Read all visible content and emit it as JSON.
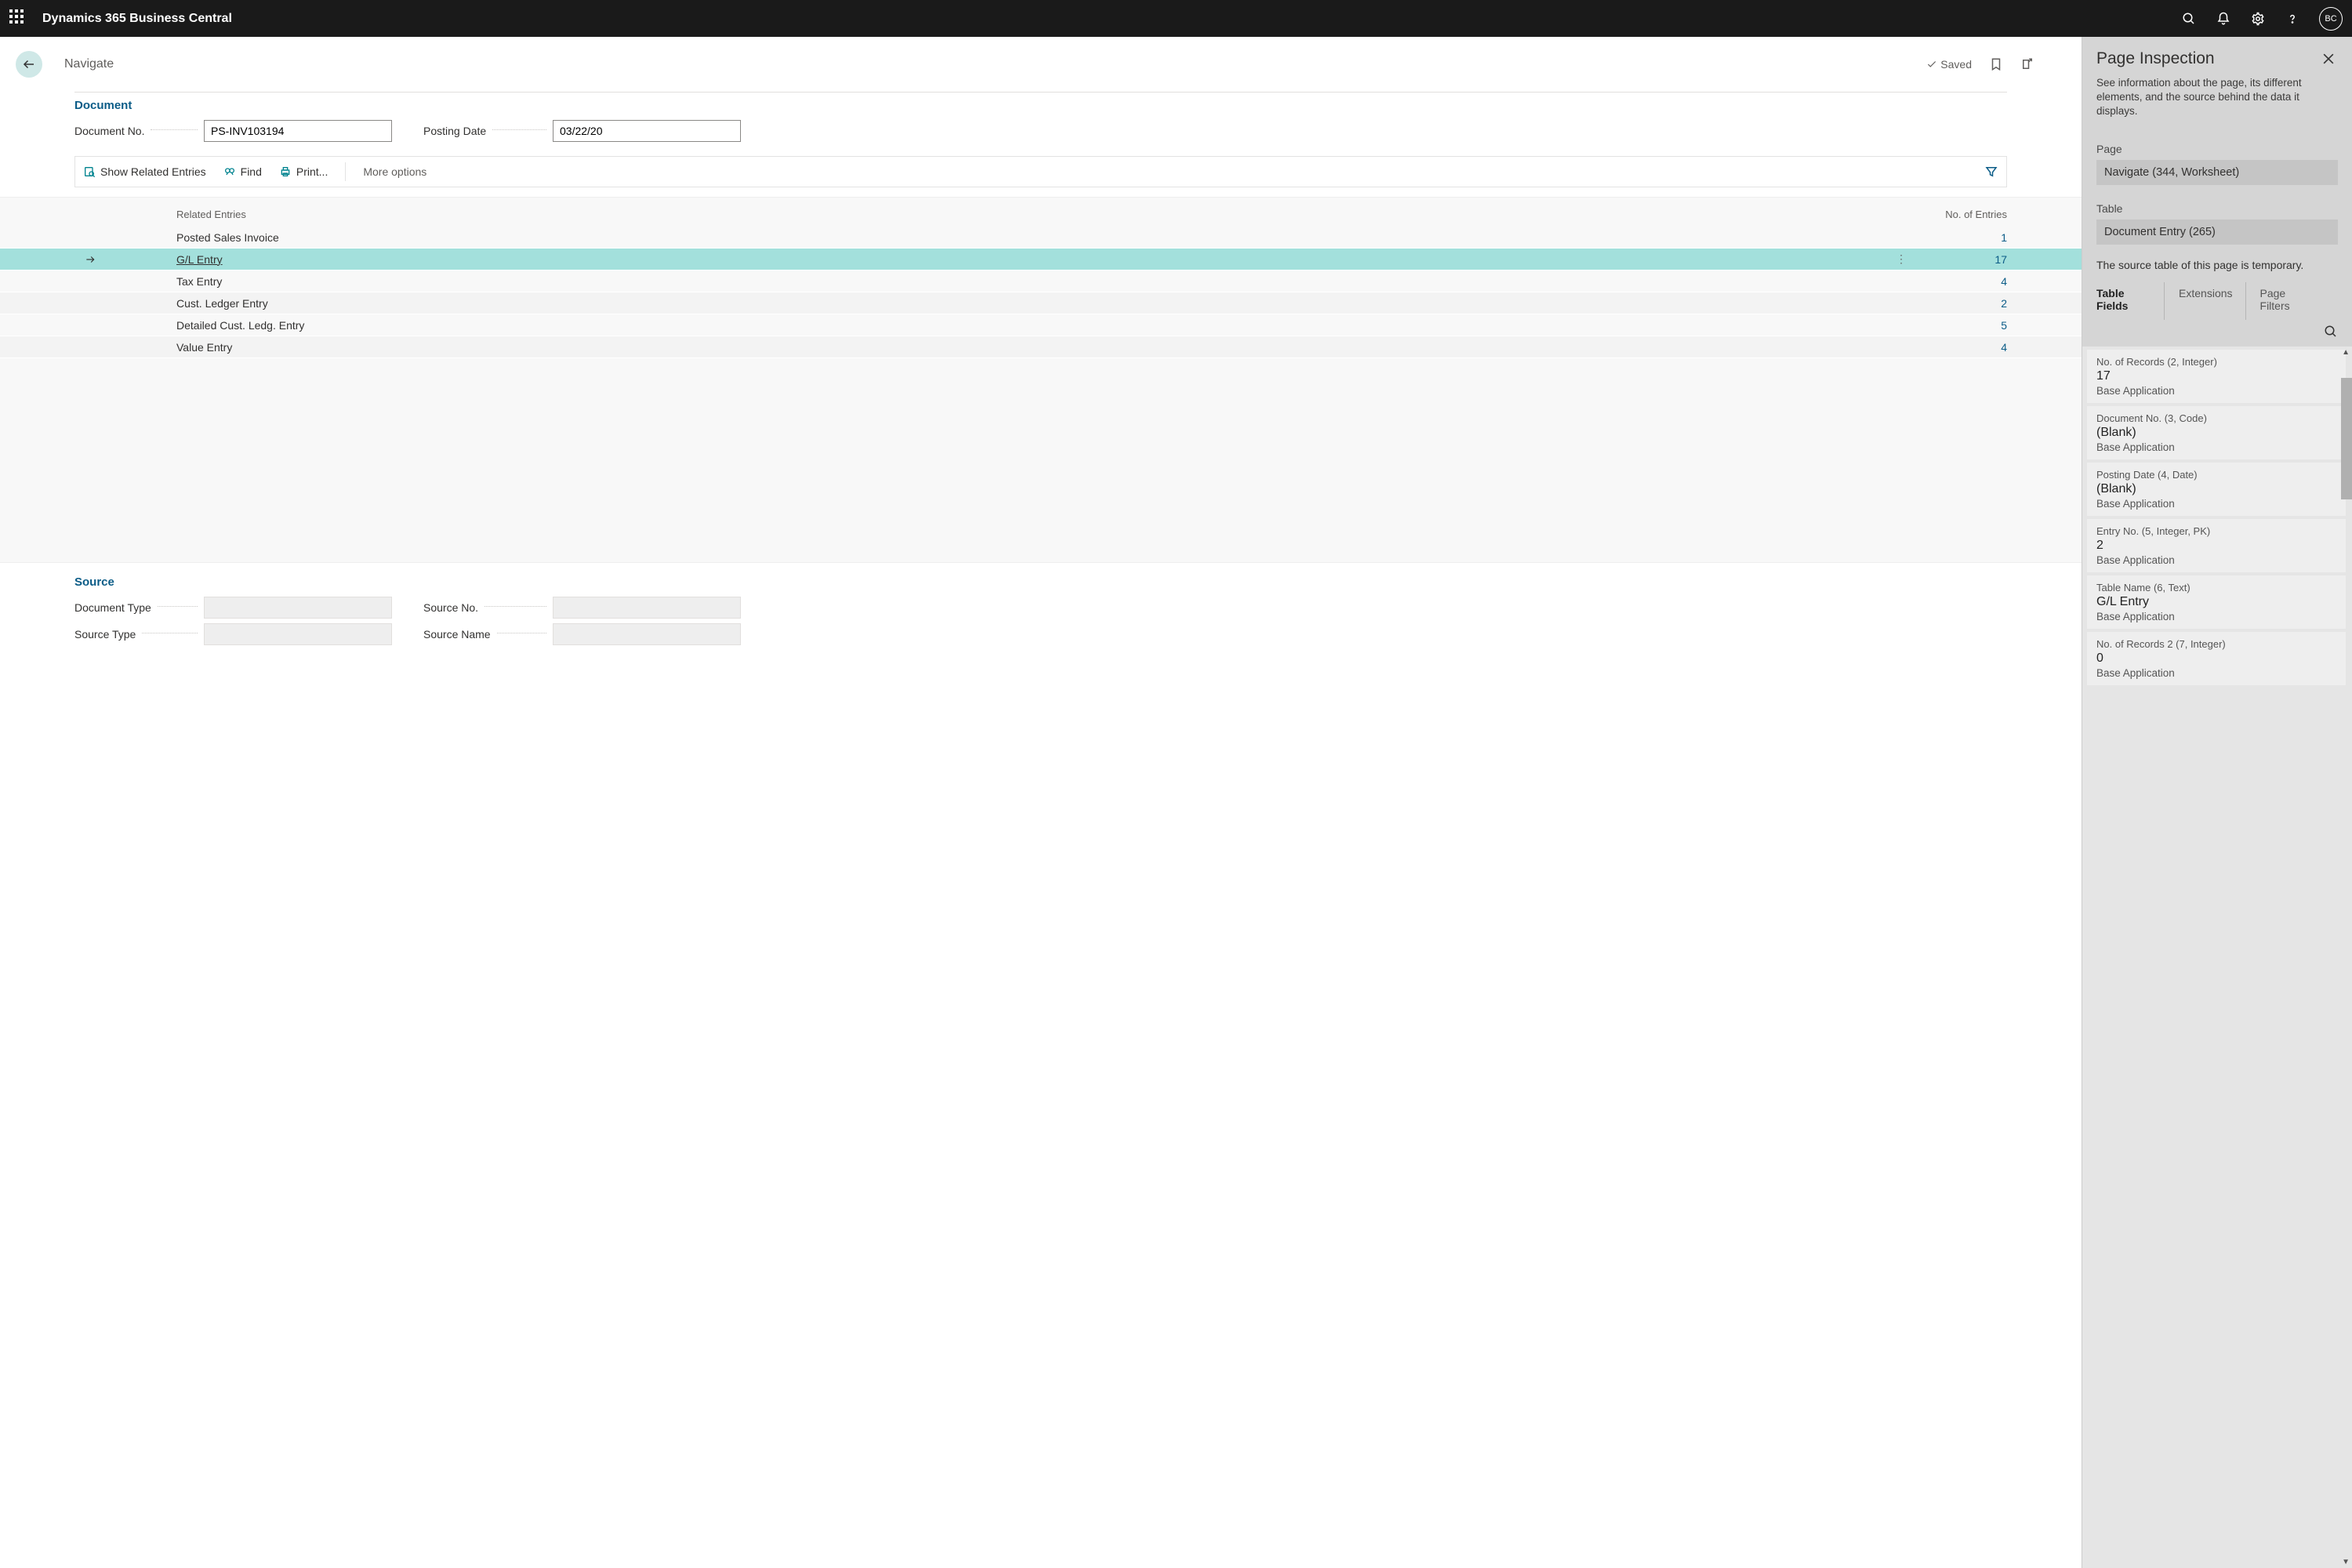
{
  "topbar": {
    "brand": "Dynamics 365 Business Central",
    "avatar": "BC"
  },
  "page": {
    "title": "Navigate",
    "saved": "Saved",
    "document_section": "Document",
    "doc_no_label": "Document No.",
    "doc_no_value": "PS-INV103194",
    "posting_date_label": "Posting Date",
    "posting_date_value": "03/22/20",
    "toolbar": {
      "show_related": "Show Related Entries",
      "find": "Find",
      "print": "Print...",
      "more": "More options"
    },
    "grid": {
      "col1": "Related Entries",
      "col2": "No. of Entries",
      "rows": [
        {
          "name": "Posted Sales Invoice",
          "count": "1",
          "selected": false
        },
        {
          "name": "G/L Entry",
          "count": "17",
          "selected": true
        },
        {
          "name": "Tax Entry",
          "count": "4",
          "selected": false
        },
        {
          "name": "Cust. Ledger Entry",
          "count": "2",
          "selected": false
        },
        {
          "name": "Detailed Cust. Ledg. Entry",
          "count": "5",
          "selected": false
        },
        {
          "name": "Value Entry",
          "count": "4",
          "selected": false
        }
      ]
    },
    "source_section": "Source",
    "source_labels": {
      "doc_type": "Document Type",
      "source_no": "Source No.",
      "source_type": "Source Type",
      "source_name": "Source Name"
    }
  },
  "inspector": {
    "title": "Page Inspection",
    "desc": "See information about the page, its different elements, and the source behind the data it displays.",
    "page_label": "Page",
    "page_value": "Navigate (344, Worksheet)",
    "table_label": "Table",
    "table_value": "Document Entry (265)",
    "note": "The source table of this page is temporary.",
    "tabs": {
      "fields": "Table Fields",
      "ext": "Extensions",
      "filters": "Page Filters"
    },
    "fields": [
      {
        "meta": "No. of Records (2, Integer)",
        "val": "17",
        "src": "Base Application"
      },
      {
        "meta": "Document No. (3, Code)",
        "val": "(Blank)",
        "src": "Base Application"
      },
      {
        "meta": "Posting Date (4, Date)",
        "val": "(Blank)",
        "src": "Base Application"
      },
      {
        "meta": "Entry No. (5, Integer, PK)",
        "val": "2",
        "src": "Base Application"
      },
      {
        "meta": "Table Name (6, Text)",
        "val": "G/L Entry",
        "src": "Base Application"
      },
      {
        "meta": "No. of Records 2 (7, Integer)",
        "val": "0",
        "src": "Base Application"
      }
    ]
  }
}
